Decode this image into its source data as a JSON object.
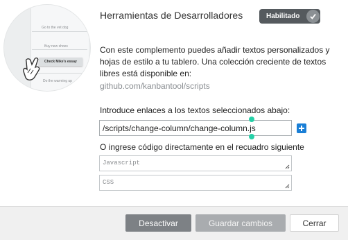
{
  "header": {
    "title": "Herramientas de Desarrolladores",
    "status_label": "Habilitado"
  },
  "illustration": {
    "tasks": [
      "Go to the vet dog",
      "Buy new shoes",
      "Check Mike's essay",
      "Do the warming up"
    ]
  },
  "description": {
    "text": "Con este complemento puedes añadir textos personalizados y hojas de estilo a tu tablero. Una colección creciente de textos libres está disponible en:",
    "link": "github.com/kanbantool/scripts"
  },
  "scripts": {
    "label": "Introduce enlaces a los textos seleccionados abajo:",
    "url_value": "/scripts/change-column/change-column.js"
  },
  "code": {
    "label": "O ingrese código directamente en el recuadro siguiente",
    "javascript_placeholder": "Javascript",
    "css_placeholder": "CSS"
  },
  "footer": {
    "deactivate_label": "Desactivar",
    "save_label": "Guardar cambios",
    "close_label": "Cerrar"
  },
  "colors": {
    "toggle_bg": "#555a5e",
    "add_button": "#1a7fd6",
    "selection_handle": "#25d0a7",
    "deactivate_bg": "#7d8185",
    "save_bg": "#a9acaf"
  }
}
